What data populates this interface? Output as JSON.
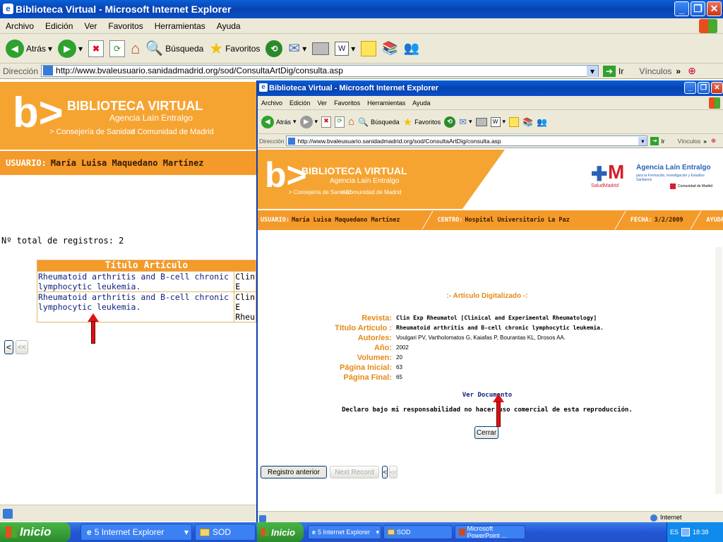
{
  "outer": {
    "title": "Biblioteca Virtual - Microsoft Internet Explorer",
    "menu": [
      "Archivo",
      "Edición",
      "Ver",
      "Favoritos",
      "Herramientas",
      "Ayuda"
    ],
    "toolbar": {
      "back": "Atrás",
      "search": "Búsqueda",
      "favorites": "Favoritos"
    },
    "address_label": "Dirección",
    "url": "http://www.bvaleusuario.sanidadmadrid.org/sod/ConsultaArtDig/consulta.asp",
    "go": "Ir",
    "links": "Vínculos",
    "banner": {
      "title": "BIBLIOTECA VIRTUAL",
      "subtitle": "Agencia Laín Entralgo",
      "link1": "> Consejería de Sanidad",
      "link2": "> Comunidad de Madrid"
    },
    "user_label": "USUARIO:",
    "user_name": "María Luisa  Maquedano Martínez",
    "total": "Nº total de registros: 2",
    "table": {
      "header": "Título Artículo",
      "rows": [
        {
          "title": "Rheumatoid arthritis and B-cell chronic lymphocytic leukemia.",
          "journal": "Clin E"
        },
        {
          "title": "Rheumatoid arthritis and B-cell chronic lymphocytic leukemia.",
          "journal": "Clin E Rheu"
        }
      ]
    },
    "nav": {
      "prev": "<",
      "first": "<<"
    }
  },
  "inner": {
    "title": "Biblioteca Virtual - Microsoft Internet Explorer",
    "menu": [
      "Archivo",
      "Edición",
      "Ver",
      "Favoritos",
      "Herramientas",
      "Ayuda"
    ],
    "toolbar": {
      "back": "Atrás",
      "search": "Búsqueda",
      "favorites": "Favoritos"
    },
    "address_label": "Dirección",
    "url": "http://www.bvaleusuario.sanidadmadrid.org/sod/ConsultaArtDig/consulta.asp",
    "go": "Ir",
    "links": "Vínculos",
    "banner": {
      "title": "BIBLIOTECA VIRTUAL",
      "subtitle": "Agencia Laín Entralgo",
      "link1": "> Consejería de Sanidad",
      "link2": "> Comunidad de Madrid",
      "agency": "Agencia Laín Entralgo",
      "agency_sub": "para la Formación, Investigación y Estudios Sanitarios",
      "salud": "SaludMadrid",
      "comunidad": "Comunidad de Madrid"
    },
    "user_label": "USUARIO:",
    "user_name": "María Luisa  Maquedano Martínez",
    "centro_label": "CENTRO:",
    "centro": "Hospital Universitario La Paz",
    "fecha_label": "FECHA:",
    "fecha": "3/2/2009",
    "ayuda": "AYUDA",
    "section": ":- Artículo Digitalizado -:",
    "fields": [
      {
        "label": "Revista:",
        "value": "Clin Exp Rheumatol [Clinical and Experimental Rheumatology]",
        "bold": true
      },
      {
        "label": "Título Artículo :",
        "value": "Rheumatoid arthritis and B-cell chronic lymphocytic leukemia.",
        "bold": true
      },
      {
        "label": "Autor/es:",
        "value": "Voulgari PV, Vartholomatos G, Kaiafas P, Bourantas KL, Drosos AA."
      },
      {
        "label": "Año:",
        "value": "2002"
      },
      {
        "label": "Volumen:",
        "value": "20"
      },
      {
        "label": "Página Inicial:",
        "value": "63"
      },
      {
        "label": "Página Final:",
        "value": "65"
      }
    ],
    "ver_doc": "Ver Documento",
    "declaro": "Declaro bajo mi responsabilidad no hacer uso comercial de esta reproducción.",
    "cerrar": "Cerrar",
    "prev_record": "Registro anterior",
    "next_record": "Next Record",
    "status": "Internet"
  },
  "taskbar": {
    "start": "Inicio",
    "tasks_left": [
      "5 Internet Explorer",
      "SOD"
    ],
    "tasks_right": [
      "5 Internet Explorer",
      "SOD",
      "Microsoft PowerPoint ..."
    ],
    "lang": "ES",
    "time": "18:38"
  }
}
